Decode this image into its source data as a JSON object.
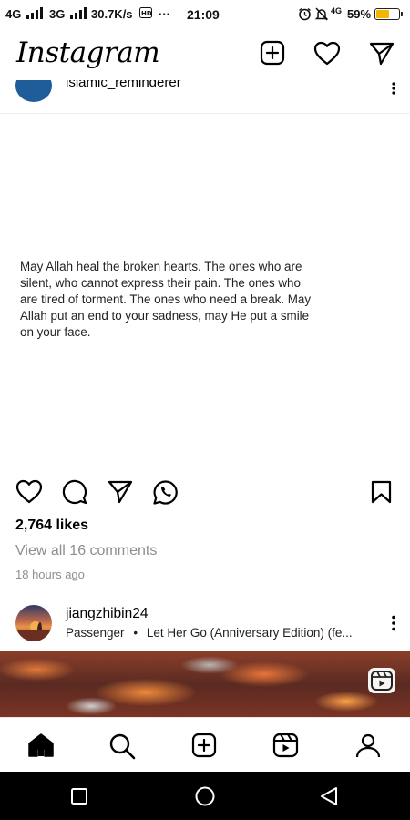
{
  "status_bar": {
    "net1": "4G",
    "net2": "3G",
    "speed": "30.7K/s",
    "dots": "···",
    "time": "21:09",
    "net3": "4G",
    "battery": "59%",
    "battery_fraction": 0.59,
    "battery_color": "#f5b400"
  },
  "header": {
    "logo": "Instagram",
    "icons": [
      "new-post-icon",
      "activity-heart-icon",
      "direct-message-icon"
    ]
  },
  "post": {
    "username": "islamic_reminderer",
    "caption_image_text": "May Allah heal the broken hearts. The ones who are silent, who cannot express their pain. The ones who are tired of torment. The ones who need a break. May Allah put an end to your sadness, may He put a smile on your face.",
    "likes": "2,764 likes",
    "view_comments": "View all 16 comments",
    "timestamp": "18 hours ago"
  },
  "next_post": {
    "username": "jiangzhibin24",
    "audio_artist": "Passenger",
    "audio_separator": "•",
    "audio_title": "Let Her Go (Anniversary Edition) (fe..."
  },
  "bottom_nav": [
    "home-icon",
    "search-icon",
    "create-icon",
    "reels-icon",
    "profile-icon"
  ],
  "colors": {
    "muted_text": "#8e8e8e",
    "accent": "#000000"
  }
}
